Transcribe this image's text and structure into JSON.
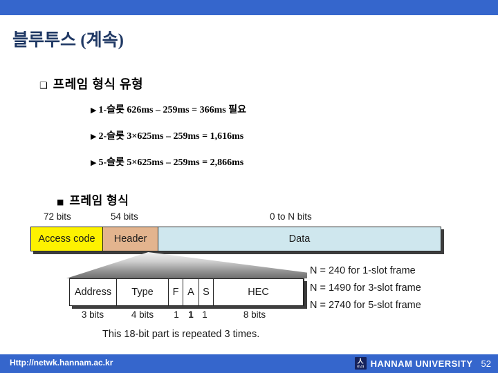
{
  "banner": {
    "color": "#3566cc"
  },
  "title": "블루투스 (계속)",
  "sections": {
    "types": {
      "marker": "❑",
      "heading": "프레임 형식  유형",
      "items": [
        {
          "marker": "▶",
          "text": "1-슬롯 626ms – 259ms = 366ms 필요"
        },
        {
          "marker": "▶",
          "text": "2-슬롯 3×625ms – 259ms = 1,616ms"
        },
        {
          "marker": "▶",
          "text": "5-슬롯 5×625ms – 259ms = 2,866ms"
        }
      ]
    },
    "format": {
      "marker": "■",
      "heading": "프레임 형식"
    }
  },
  "figure": {
    "top_bit_labels": {
      "access": "72 bits",
      "header": "54 bits",
      "data": "0 to N bits"
    },
    "frame_fields": [
      {
        "label": "Access code",
        "color": "#fdf200"
      },
      {
        "label": "Header",
        "color": "#e3b48e"
      },
      {
        "label": "Data",
        "color": "#cfe7ee"
      }
    ],
    "header_fields": [
      {
        "label": "Address",
        "bits": "3 bits",
        "color": "#ffffff"
      },
      {
        "label": "Type",
        "bits": "4 bits",
        "color": "#ffffff"
      },
      {
        "label": "F",
        "bits": "1",
        "color": "#fbd3e0"
      },
      {
        "label": "A",
        "bits": "1",
        "color": "#fbd3e0"
      },
      {
        "label": "S",
        "bits": "1",
        "color": "#fbd3e0"
      },
      {
        "label": "HEC",
        "bits": "8 bits",
        "color": "#ffffff"
      }
    ],
    "caption": "This 18-bit part is repeated 3 times.",
    "n_notes": [
      "N = 240  for 1-slot frame",
      "N = 1490  for 3-slot frame",
      "N = 2740  for 5-slot frame"
    ]
  },
  "footer": {
    "url": "Http://netwk.hannam.ac.kr",
    "logo_glyph": "人",
    "logo_sub": "한남대",
    "university": "HANNAM  UNIVERSITY",
    "page": "52",
    "color": "#3566cc"
  }
}
